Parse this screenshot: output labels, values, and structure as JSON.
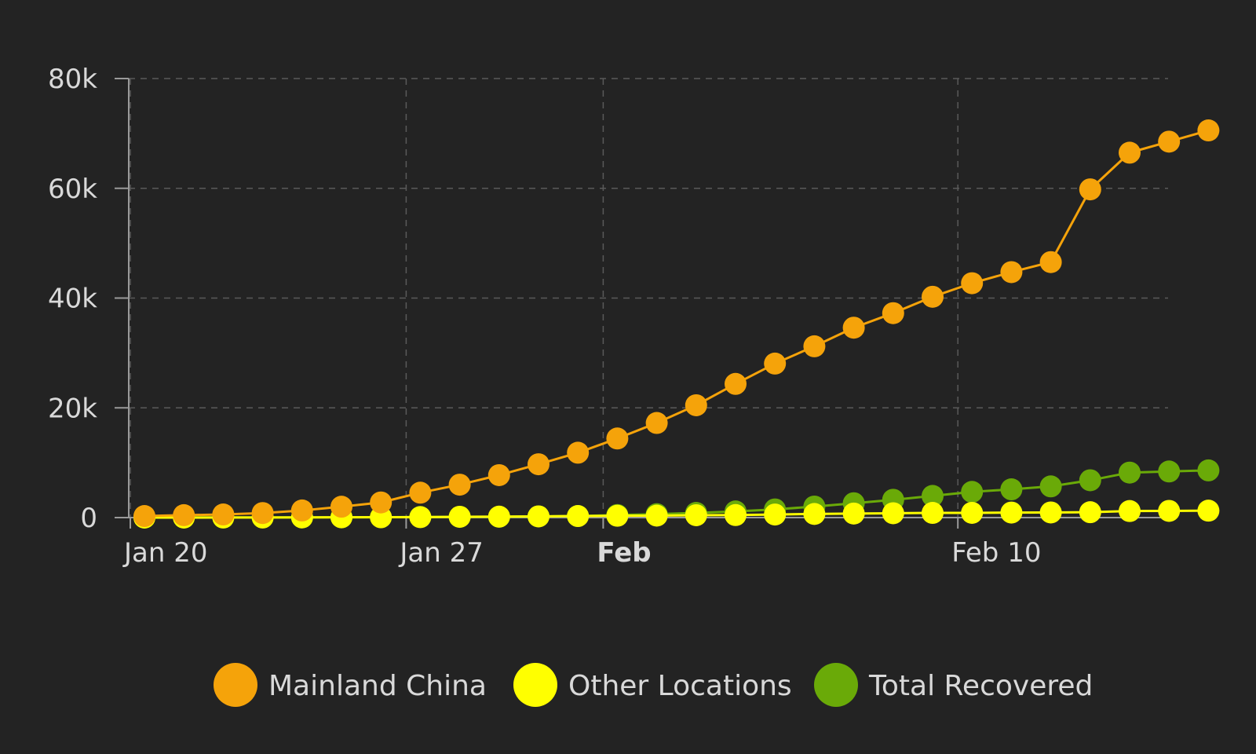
{
  "chart_data": {
    "type": "line",
    "x": [
      "Jan 20",
      "Jan 21",
      "Jan 22",
      "Jan 23",
      "Jan 24",
      "Jan 25",
      "Jan 26",
      "Jan 27",
      "Jan 28",
      "Jan 29",
      "Jan 30",
      "Jan 31",
      "Feb 1",
      "Feb 2",
      "Feb 3",
      "Feb 4",
      "Feb 5",
      "Feb 6",
      "Feb 7",
      "Feb 8",
      "Feb 9",
      "Feb 10",
      "Feb 11",
      "Feb 12",
      "Feb 13",
      "Feb 14",
      "Feb 15",
      "Feb 16"
    ],
    "x_ticks": [
      {
        "date": "Jan 20",
        "label": "Jan 20",
        "bold": false
      },
      {
        "date": "Jan 27",
        "label": "Jan 27",
        "bold": false
      },
      {
        "date": "Feb 1",
        "label": "Feb",
        "bold": true
      },
      {
        "date": "Feb 10",
        "label": "Feb 10",
        "bold": false
      }
    ],
    "y_ticks": [
      {
        "value": 0,
        "label": "0"
      },
      {
        "value": 20000,
        "label": "20k"
      },
      {
        "value": 40000,
        "label": "40k"
      },
      {
        "value": 60000,
        "label": "60k"
      },
      {
        "value": 80000,
        "label": "80k"
      }
    ],
    "ylim": [
      0,
      80000
    ],
    "grid": true,
    "legend_position": "bottom",
    "series": [
      {
        "name": "Mainland China",
        "color": "#f5a30a",
        "values": [
          278,
          440,
          571,
          830,
          1297,
          1985,
          2761,
          4537,
          5997,
          7736,
          9720,
          11821,
          14411,
          17238,
          20471,
          24363,
          28060,
          31211,
          34598,
          37251,
          40235,
          42708,
          44730,
          46550,
          59804,
          66492,
          68500,
          70548
        ]
      },
      {
        "name": "Other Locations",
        "color": "#ffff00",
        "values": [
          4,
          7,
          10,
          16,
          39,
          56,
          68,
          82,
          146,
          177,
          217,
          281,
          332,
          358,
          436,
          458,
          558,
          662,
          742,
          795,
          850,
          867,
          913,
          934,
          983,
          1190,
          1217,
          1263
        ]
      },
      {
        "name": "Total Recovered",
        "color": "#6aaa08",
        "values": [
          0,
          28,
          30,
          36,
          39,
          52,
          61,
          107,
          126,
          143,
          222,
          284,
          472,
          623,
          852,
          1124,
          1487,
          2011,
          2616,
          3244,
          3946,
          4683,
          5150,
          5688,
          6800,
          8200,
          8400,
          8600
        ]
      }
    ]
  }
}
